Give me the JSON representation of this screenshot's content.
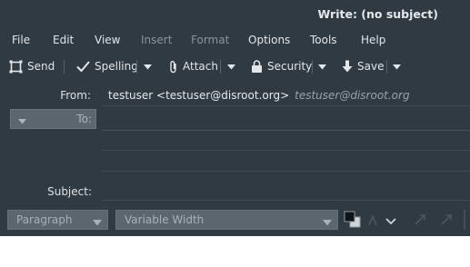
{
  "window": {
    "title": "Write: (no subject)"
  },
  "menubar": {
    "items": [
      {
        "label": "File",
        "disabled": false
      },
      {
        "label": "Edit",
        "disabled": false
      },
      {
        "label": "View",
        "disabled": false
      },
      {
        "label": "Insert",
        "disabled": true
      },
      {
        "label": "Format",
        "disabled": true
      },
      {
        "label": "Options",
        "disabled": false
      },
      {
        "label": "Tools",
        "disabled": false
      },
      {
        "label": "Help",
        "disabled": false
      }
    ]
  },
  "toolbar": {
    "send_label": "Send",
    "spelling_label": "Spelling",
    "attach_label": "Attach",
    "security_label": "Security",
    "save_label": "Save"
  },
  "header": {
    "from_label": "From:",
    "from_value": "testuser <testuser@disroot.org>",
    "from_identity": "testuser@disroot.org",
    "to_label": "To:",
    "subject_label": "Subject:"
  },
  "format_bar": {
    "paragraph_value": "Paragraph",
    "font_value": "Variable Width"
  },
  "colors": {
    "window_bg": "#2f3a42",
    "field_bg": "#5b666e",
    "text": "#e4e6e8",
    "disabled_text": "#8a949b"
  }
}
